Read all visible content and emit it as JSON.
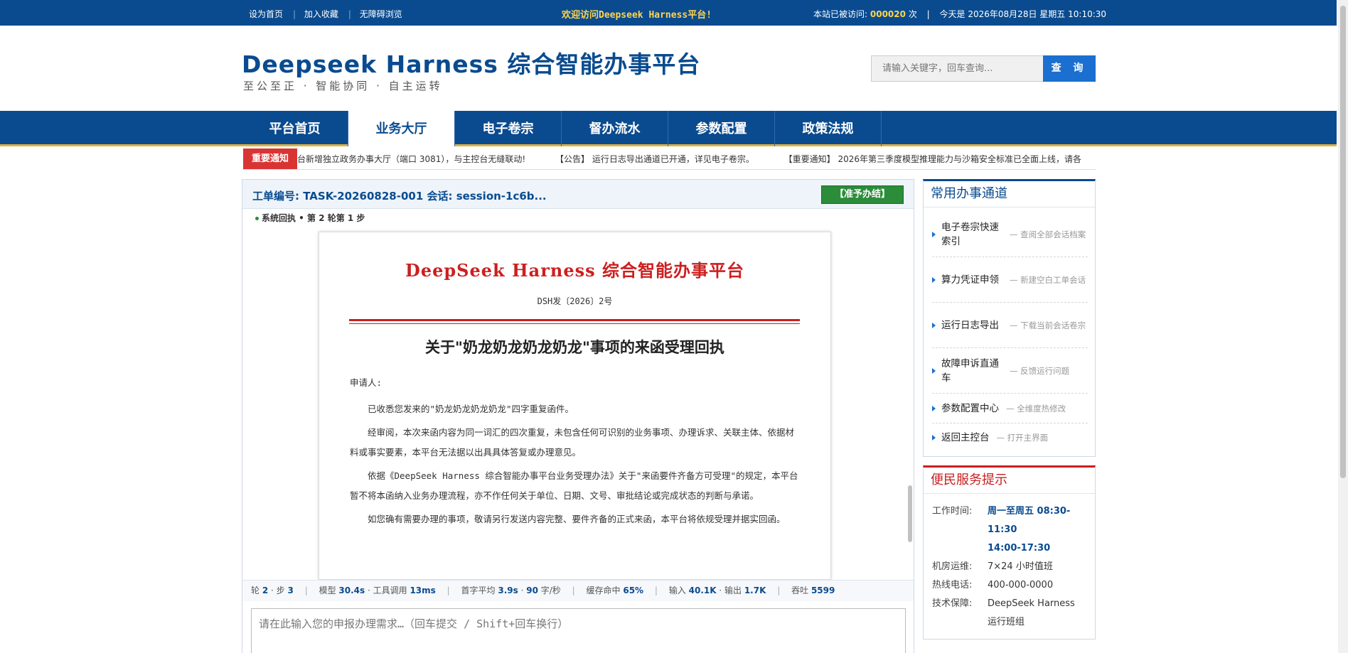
{
  "topbar": {
    "links": [
      "设为首页",
      "加入收藏",
      "无障碍浏览"
    ],
    "welcome": "欢迎访问Deepseek Harness平台!",
    "visits_label": "本站已被访问:",
    "visits_count": "000020",
    "visits_unit": "次",
    "today_label": "今天是",
    "date": "2026年08月28日",
    "weekday": "星期五",
    "time": "10:10:30"
  },
  "header": {
    "title": "Deepseek Harness 综合智能办事平台",
    "subtitle": "至公至正 · 智能协同 · 自主运转",
    "search_placeholder": "请输入关键字，回车查询...",
    "search_button": "查 询"
  },
  "nav": {
    "items": [
      "平台首页",
      "业务大厅",
      "电子卷宗",
      "督办流水",
      "参数配置",
      "政策法规"
    ],
    "active": "业务大厅"
  },
  "notice": {
    "tag": "重要通知",
    "items": [
      "台新增独立政务办事大厅（端口 3081），与主控台无缝联动!",
      "【公告】 运行日志导出通道已开通，详见电子卷宗。",
      "【重要通知】 2026年第三季度模型推理能力与沙箱安全标准已全面上线，请各"
    ]
  },
  "task": {
    "label": "工单编号: TASK-20260828-001   会话: session-1c6b...",
    "approve_button": "【准予办结】",
    "status": "系统回执 • 第 2 轮第 1 步"
  },
  "document": {
    "org_title": "DeepSeek Harness 综合智能办事平台",
    "doc_number": "DSH发〔2026〕2号",
    "subject": "关于\"奶龙奶龙奶龙奶龙\"事项的来函受理回执",
    "salutation": "申请人:",
    "paragraphs": [
      "已收悉您发来的\"奶龙奶龙奶龙奶龙\"四字重复函件。",
      "经审阅，本次来函内容为同一词汇的四次重复，未包含任何可识别的业务事项、办理诉求、关联主体、依据材料或事实要素，本平台无法据以出具具体答复或办理意见。",
      "依据《DeepSeek Harness 综合智能办事平台业务受理办法》关于\"来函要件齐备方可受理\"的规定，本平台暂不将本函纳入业务办理流程，亦不作任何关于单位、日期、文号、审批结论或完成状态的判断与承诺。",
      "如您确有需要办理的事项，敬请另行发送内容完整、要件齐备的正式来函，本平台将依规受理并据实回函。"
    ]
  },
  "metrics": {
    "round_label": "轮",
    "round": "2",
    "step_label": "步",
    "step": "3",
    "model_label": "模型",
    "model_time": "30.4s",
    "tool_label": "工具调用",
    "tool_time": "13ms",
    "first_label": "首字平均",
    "first_time": "3.9s",
    "speed": "90",
    "speed_unit": "字/秒",
    "cache_label": "缓存命中",
    "cache": "65%",
    "in_label": "输入",
    "input": "40.1K",
    "out_label": "输出",
    "output": "1.7K",
    "tp_label": "吞吐",
    "throughput": "5599"
  },
  "input": {
    "placeholder": "请在此输入您的申报办理需求…（回车提交 / Shift+回车换行）"
  },
  "sidebar": {
    "quick_title": "常用办事通道",
    "quick_items": [
      {
        "name": "电子卷宗快速索引",
        "desc": "— 查阅全部会话档案"
      },
      {
        "name": "算力凭证申领",
        "desc": "— 新建空白工单会话"
      },
      {
        "name": "运行日志导出",
        "desc": "— 下载当前会话卷宗"
      },
      {
        "name": "故障申诉直通车",
        "desc": "— 反馈运行问题"
      },
      {
        "name": "参数配置中心",
        "desc": "— 全维度热修改"
      },
      {
        "name": "返回主控台",
        "desc": "— 打开主界面"
      }
    ],
    "service_title": "便民服务提示",
    "service": {
      "hours_label": "工作时间:",
      "hours_1": "周一至周五 08:30-11:30",
      "hours_2": "14:00-17:30",
      "ops_label": "机房运维:",
      "ops": "7×24 小时值班",
      "hotline_label": "热线电话:",
      "hotline": "400-000-0000",
      "support_label": "技术保障:",
      "support": "DeepSeek Harness 运行班组"
    }
  }
}
